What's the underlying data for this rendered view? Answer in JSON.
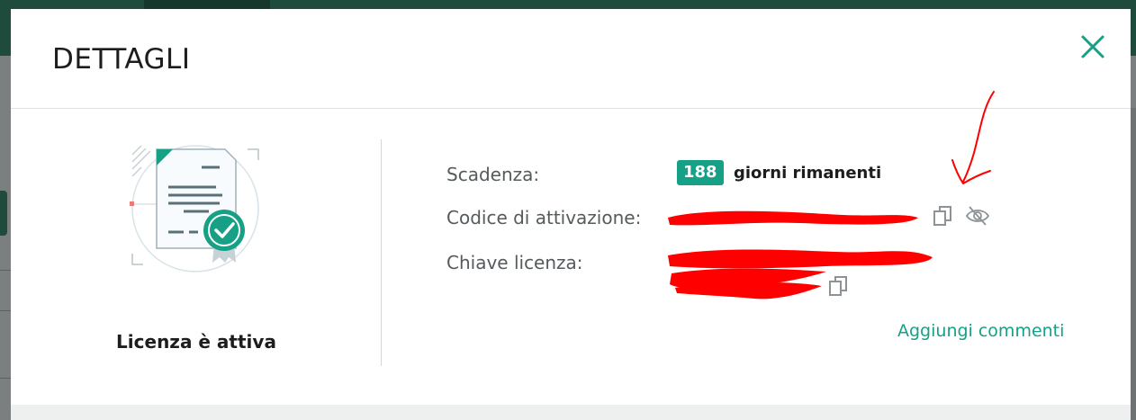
{
  "dialog": {
    "title": "DETTAGLI",
    "close_icon": "close-icon"
  },
  "license": {
    "status_label": "Licenza è attiva",
    "illustration_icon": "certificate-icon"
  },
  "details": {
    "expiry_label": "Scadenza:",
    "days_remaining": "188",
    "days_text": "giorni rimanenti",
    "activation_code_label": "Codice di attivazione:",
    "license_key_label": "Chiave licenza:",
    "copy_icon": "copy-icon",
    "hide_icon": "eye-off-icon"
  },
  "actions": {
    "add_comments": "Aggiungi commenti"
  },
  "colors": {
    "accent": "#16a085",
    "annotation": "#ff0000",
    "header_bar": "#1f4b3c"
  }
}
